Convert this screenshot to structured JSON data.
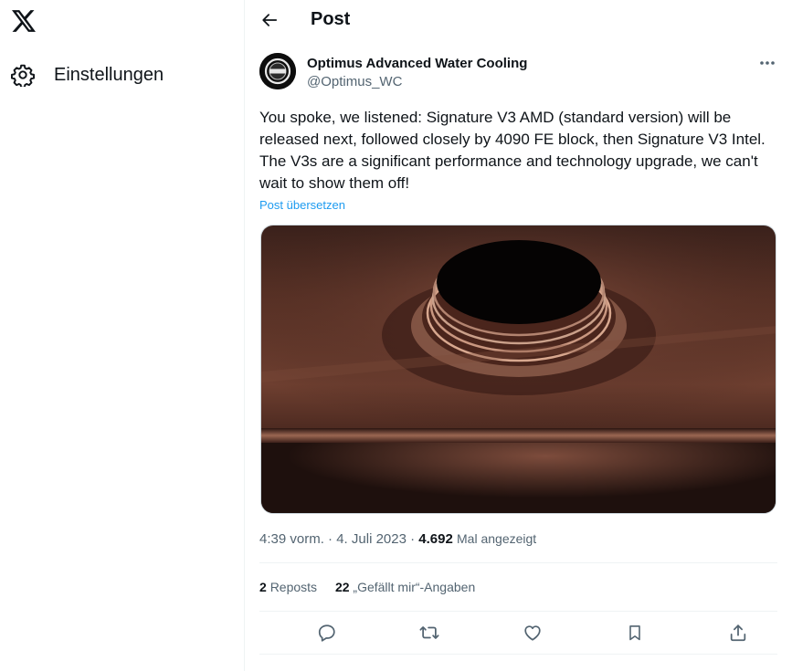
{
  "nav": {
    "logo_icon": "x-logo-icon",
    "items": [
      {
        "label": "Einstellungen",
        "icon": "gear-icon"
      }
    ]
  },
  "header": {
    "title": "Post",
    "back_icon": "arrow-left-icon"
  },
  "post": {
    "author_name": "Optimus Advanced Water Cooling",
    "author_handle": "@Optimus_WC",
    "text": "You spoke, we listened: Signature V3 AMD (standard version) will be released next, followed closely by 4090 FE block, then Signature V3 Intel. The V3s are a significant performance and technology upgrade, we can't wait to show them off!",
    "translate_label": "Post übersetzen",
    "time": "4:39 vorm.",
    "separator": "·",
    "date": "4. Juli 2023",
    "views_count": "4.692",
    "views_label": "Mal angezeigt",
    "reposts_count": "2",
    "reposts_label": "Reposts",
    "likes_count": "22",
    "likes_label": "„Gefällt mir“-Angaben"
  },
  "actions": [
    "reply-icon",
    "repost-icon",
    "like-icon",
    "bookmark-icon",
    "share-icon"
  ],
  "colors": {
    "text": "#0f1419",
    "secondary": "#536471",
    "link": "#1d9bf0",
    "divider": "#eff3f4"
  }
}
